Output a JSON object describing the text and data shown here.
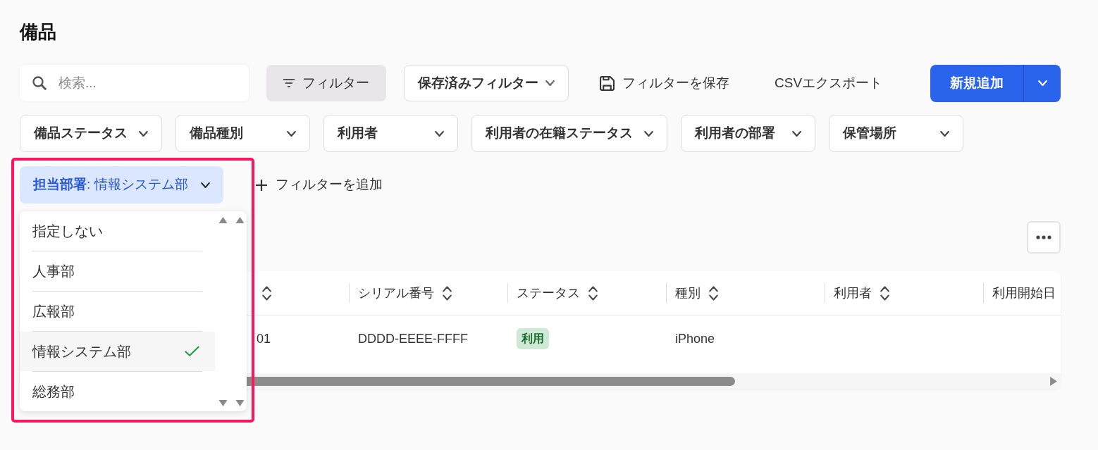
{
  "page": {
    "title": "備品"
  },
  "toolbar": {
    "search": {
      "placeholder": "検索..."
    },
    "filter": {
      "label": "フィルター",
      "pressed": true
    },
    "saved_filters": {
      "label": "保存済みフィルター"
    },
    "save_filter": {
      "label": "フィルターを保存"
    },
    "csv_export": {
      "label": "CSVエクスポート"
    },
    "add_new": {
      "label": "新規追加"
    }
  },
  "filters": [
    {
      "label": "備品ステータス"
    },
    {
      "label": "備品種別"
    },
    {
      "label": "利用者"
    },
    {
      "label": "利用者の在籍ステータス"
    },
    {
      "label": "利用者の部署"
    },
    {
      "label": "保管場所"
    }
  ],
  "active_filter": {
    "label": "**担当部署**: 情報システム部",
    "expanded": true,
    "options": [
      {
        "label": "指定しない",
        "selected": false
      },
      {
        "label": "人事部",
        "selected": false
      },
      {
        "label": "広報部",
        "selected": false
      },
      {
        "label": "情報システム部",
        "selected": true
      },
      {
        "label": "総務部",
        "selected": false
      }
    ]
  },
  "add_filter": {
    "label": "フィルターを追加"
  },
  "table": {
    "columns": [
      {
        "sortable": true
      },
      {
        "label": "シリアル番号",
        "sortable": true
      },
      {
        "label": "ステータス",
        "sortable": true
      },
      {
        "label": "種別",
        "sortable": true
      },
      {
        "label": "利用者",
        "sortable": true
      },
      {
        "label": "利用開始日",
        "sortable": false
      }
    ],
    "rows": [
      {
        "cells": [
          {
            "kind": "text",
            "text": "01"
          },
          {
            "kind": "text",
            "text": "DDDD-EEEE-FFFF"
          },
          {
            "kind": "badge",
            "text": "利用"
          },
          {
            "kind": "text",
            "text": "iPhone"
          }
        ]
      }
    ]
  }
}
